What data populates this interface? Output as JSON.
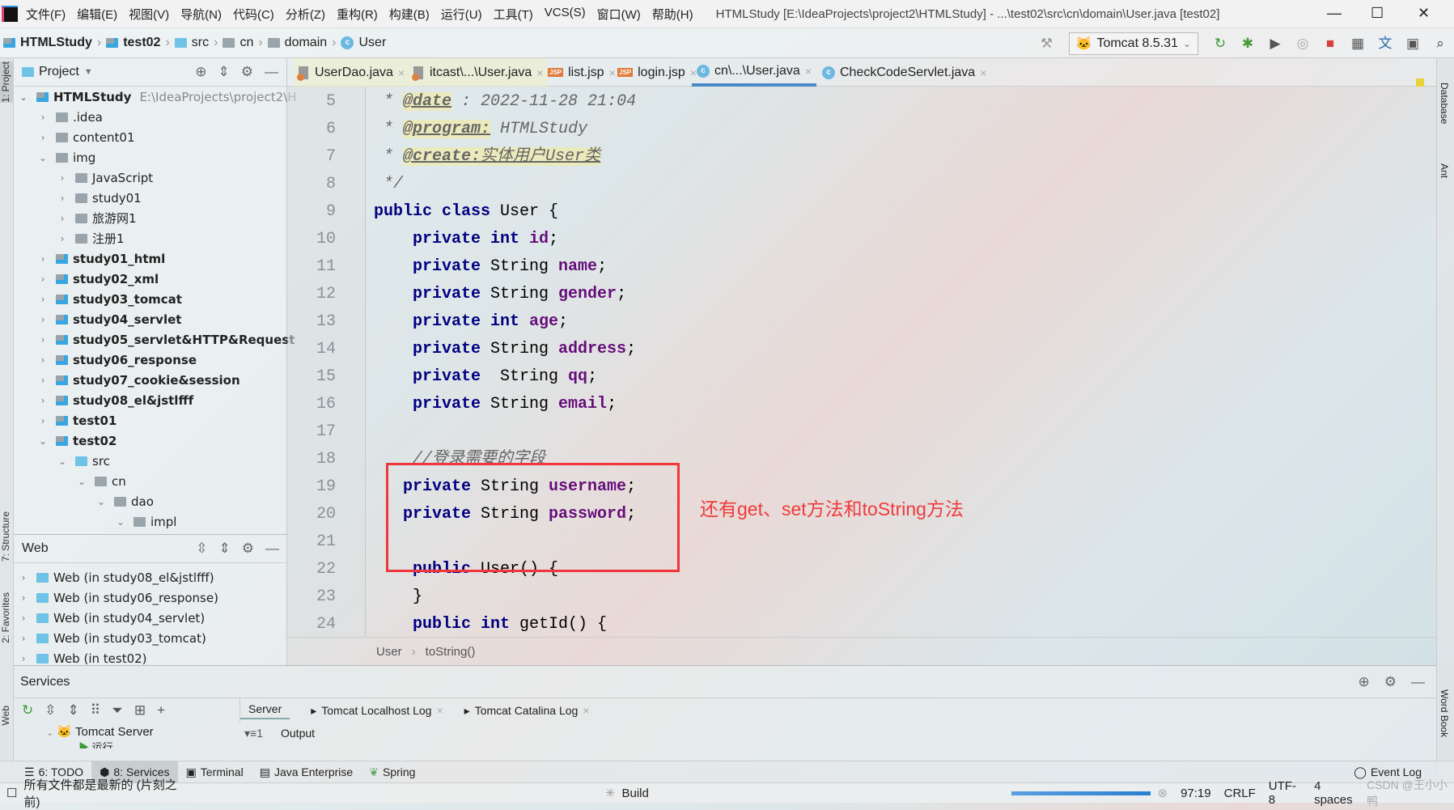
{
  "menu": {
    "items": [
      "文件(F)",
      "编辑(E)",
      "视图(V)",
      "导航(N)",
      "代码(C)",
      "分析(Z)",
      "重构(R)",
      "构建(B)",
      "运行(U)",
      "工具(T)",
      "VCS(S)",
      "窗口(W)",
      "帮助(H)"
    ],
    "title": "HTMLStudy [E:\\IdeaProjects\\project2\\HTMLStudy] - ...\\test02\\src\\cn\\domain\\User.java [test02]"
  },
  "navbar": {
    "crumbs": [
      "HTMLStudy",
      "test02",
      "src",
      "cn",
      "domain",
      "User"
    ],
    "run_config": "Tomcat 8.5.31"
  },
  "project": {
    "header": "Project",
    "tree": [
      {
        "label": "HTMLStudy",
        "hint": "E:\\IdeaProjects\\project2\\H",
        "depth": 0,
        "open": true,
        "bold": true,
        "icon": "mod"
      },
      {
        "label": ".idea",
        "depth": 1,
        "open": false,
        "icon": "folder"
      },
      {
        "label": "content01",
        "depth": 1,
        "open": false,
        "icon": "folder"
      },
      {
        "label": "img",
        "depth": 1,
        "open": true,
        "icon": "folder"
      },
      {
        "label": "JavaScript",
        "depth": 2,
        "open": false,
        "icon": "folder"
      },
      {
        "label": "study01",
        "depth": 2,
        "open": false,
        "icon": "folder"
      },
      {
        "label": "旅游网1",
        "depth": 2,
        "open": false,
        "icon": "folder"
      },
      {
        "label": "注册1",
        "depth": 2,
        "open": false,
        "icon": "folder"
      },
      {
        "label": "study01_html",
        "depth": 1,
        "open": false,
        "bold": true,
        "icon": "mod"
      },
      {
        "label": "study02_xml",
        "depth": 1,
        "open": false,
        "bold": true,
        "icon": "mod"
      },
      {
        "label": "study03_tomcat",
        "depth": 1,
        "open": false,
        "bold": true,
        "icon": "mod"
      },
      {
        "label": "study04_servlet",
        "depth": 1,
        "open": false,
        "bold": true,
        "icon": "mod"
      },
      {
        "label": "study05_servlet&HTTP&Request",
        "depth": 1,
        "open": false,
        "bold": true,
        "icon": "mod"
      },
      {
        "label": "study06_response",
        "depth": 1,
        "open": false,
        "bold": true,
        "icon": "mod"
      },
      {
        "label": "study07_cookie&session",
        "depth": 1,
        "open": false,
        "bold": true,
        "icon": "mod"
      },
      {
        "label": "study08_el&jstlfff",
        "depth": 1,
        "open": false,
        "bold": true,
        "icon": "mod"
      },
      {
        "label": "test01",
        "depth": 1,
        "open": false,
        "bold": true,
        "icon": "mod"
      },
      {
        "label": "test02",
        "depth": 1,
        "open": true,
        "bold": true,
        "icon": "mod"
      },
      {
        "label": "src",
        "depth": 2,
        "open": true,
        "icon": "blue"
      },
      {
        "label": "cn",
        "depth": 3,
        "open": true,
        "icon": "folder"
      },
      {
        "label": "dao",
        "depth": 4,
        "open": true,
        "icon": "folder"
      },
      {
        "label": "impl",
        "depth": 5,
        "open": true,
        "icon": "folder"
      }
    ]
  },
  "web": {
    "header": "Web",
    "items": [
      "Web (in study08_el&jstlfff)",
      "Web (in study06_response)",
      "Web (in study04_servlet)",
      "Web (in study03_tomcat)",
      "Web (in test02)"
    ]
  },
  "tabs": [
    {
      "label": "UserDao.java",
      "icon": "java",
      "pinned": true
    },
    {
      "label": "itcast\\...\\User.java",
      "icon": "java",
      "pinned": true
    },
    {
      "label": "list.jsp",
      "icon": "jsp"
    },
    {
      "label": "login.jsp",
      "icon": "jsp"
    },
    {
      "label": "cn\\...\\User.java",
      "icon": "class",
      "active": true
    },
    {
      "label": "CheckCodeServlet.java",
      "icon": "class"
    }
  ],
  "code": [
    {
      "n": "5",
      "s": [
        [
          "cm",
          " * "
        ],
        [
          "tag",
          "@date"
        ],
        [
          "cm",
          " : 2022-11-28 21:04"
        ]
      ]
    },
    {
      "n": "6",
      "s": [
        [
          "cm",
          " * "
        ],
        [
          "tag",
          "@program:"
        ],
        [
          "cm",
          " HTMLStudy"
        ]
      ]
    },
    {
      "n": "7",
      "s": [
        [
          "cm",
          " * "
        ],
        [
          "tag",
          "@create:"
        ],
        [
          "tagv",
          "实体用户User类"
        ]
      ]
    },
    {
      "n": "8",
      "s": [
        [
          "cm",
          " */"
        ]
      ]
    },
    {
      "n": "9",
      "s": [
        [
          "kw",
          "public class "
        ],
        [
          "plain",
          "User {"
        ]
      ]
    },
    {
      "n": "10",
      "s": [
        [
          "kw",
          "    private int "
        ],
        [
          "fld",
          "id"
        ],
        [
          "plain",
          ";"
        ]
      ]
    },
    {
      "n": "11",
      "s": [
        [
          "kw",
          "    private "
        ],
        [
          "plain",
          "String "
        ],
        [
          "fld",
          "name"
        ],
        [
          "plain",
          ";"
        ]
      ]
    },
    {
      "n": "12",
      "s": [
        [
          "kw",
          "    private "
        ],
        [
          "plain",
          "String "
        ],
        [
          "fld",
          "gender"
        ],
        [
          "plain",
          ";"
        ]
      ]
    },
    {
      "n": "13",
      "s": [
        [
          "kw",
          "    private int "
        ],
        [
          "fld",
          "age"
        ],
        [
          "plain",
          ";"
        ]
      ]
    },
    {
      "n": "14",
      "s": [
        [
          "kw",
          "    private "
        ],
        [
          "plain",
          "String "
        ],
        [
          "fld",
          "address"
        ],
        [
          "plain",
          ";"
        ]
      ]
    },
    {
      "n": "15",
      "s": [
        [
          "kw",
          "    private  "
        ],
        [
          "plain",
          "String "
        ],
        [
          "fld",
          "qq"
        ],
        [
          "plain",
          ";"
        ]
      ]
    },
    {
      "n": "16",
      "s": [
        [
          "kw",
          "    private "
        ],
        [
          "plain",
          "String "
        ],
        [
          "fld",
          "email"
        ],
        [
          "plain",
          ";"
        ]
      ]
    },
    {
      "n": "17",
      "s": []
    },
    {
      "n": "18",
      "s": [
        [
          "cm",
          "    //登录需要的字段"
        ]
      ]
    },
    {
      "n": "19",
      "s": [
        [
          "kw",
          "   private "
        ],
        [
          "plain",
          "String "
        ],
        [
          "fld",
          "username"
        ],
        [
          "plain",
          ";"
        ]
      ]
    },
    {
      "n": "20",
      "s": [
        [
          "kw",
          "   private "
        ],
        [
          "plain",
          "String "
        ],
        [
          "fld",
          "password"
        ],
        [
          "plain",
          ";"
        ]
      ]
    },
    {
      "n": "21",
      "s": []
    },
    {
      "n": "22",
      "s": [
        [
          "kw",
          "    public "
        ],
        [
          "plain",
          "User() {"
        ]
      ]
    },
    {
      "n": "23",
      "s": [
        [
          "plain",
          "    }"
        ]
      ]
    },
    {
      "n": "24",
      "s": [
        [
          "kw",
          "    public int "
        ],
        [
          "plain",
          "getId() {"
        ]
      ]
    }
  ],
  "annotation": "还有get、set方法和toString方法",
  "editor_breadcrumb": [
    "User",
    "toString()"
  ],
  "services": {
    "header": "Services",
    "tabs": [
      "Server",
      "Tomcat Localhost Log",
      "Tomcat Catalina Log"
    ],
    "tree": [
      "Tomcat Server",
      "运行"
    ],
    "output_label": "Output",
    "output_count": "1"
  },
  "toolwindows": [
    "6: TODO",
    "8: Services",
    "Terminal",
    "Java Enterprise",
    "Spring"
  ],
  "event_log": "Event Log",
  "status": {
    "message": "所有文件都是最新的 (片刻之前)",
    "build": "Build",
    "position": "97:19",
    "line_sep": "CRLF",
    "encoding": "UTF-8",
    "indent": "4 spaces",
    "watermark": "CSDN @王小小鸭"
  },
  "stripes": {
    "left": [
      "1: Project",
      "7: Structure",
      "2: Favorites",
      "Web"
    ],
    "right": [
      "Database",
      "Ant",
      "Word Book"
    ]
  }
}
